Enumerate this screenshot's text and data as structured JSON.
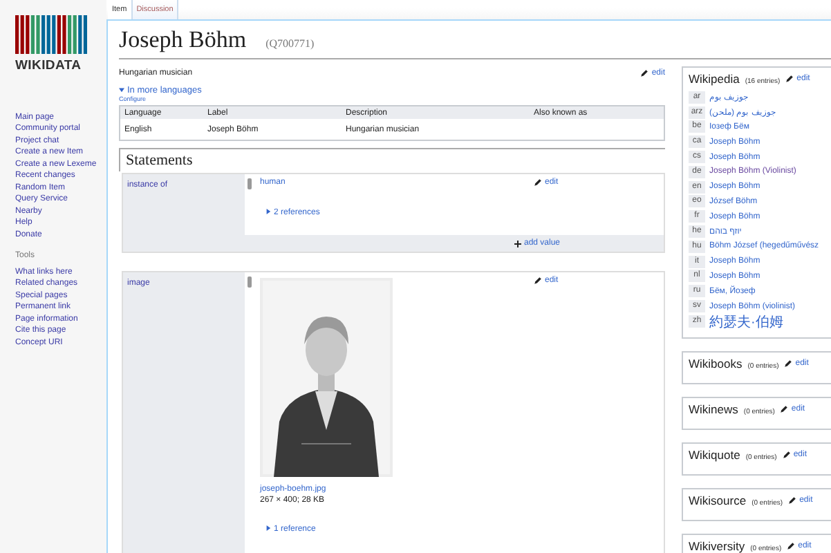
{
  "logo": {
    "wordmark": "WIKIDATA"
  },
  "sidebar": {
    "navigation": [
      "Main page",
      "Community portal",
      "Project chat",
      "Create a new Item",
      "Create a new Lexeme",
      "Recent changes",
      "Random Item",
      "Query Service",
      "Nearby",
      "Help",
      "Donate"
    ],
    "tools_heading": "Tools",
    "tools": [
      "What links here",
      "Related changes",
      "Special pages",
      "Permanent link",
      "Page information",
      "Cite this page",
      "Concept URI"
    ]
  },
  "tabs": [
    {
      "label": "Item",
      "selected": true
    },
    {
      "label": "Discussion",
      "selected": false
    }
  ],
  "title": {
    "label": "Joseph Böhm",
    "id": "(Q700771)"
  },
  "description": {
    "text": "Hungarian musician",
    "edit": "edit"
  },
  "languages": {
    "toggle": "In more languages",
    "configure": "Configure",
    "columns": [
      "Language",
      "Label",
      "Description",
      "Also known as"
    ],
    "rows": [
      {
        "language": "English",
        "label": "Joseph Böhm",
        "description": "Hungarian musician"
      }
    ]
  },
  "statements": {
    "heading": "Statements",
    "groups": [
      {
        "kind": "item",
        "property": "instance of",
        "value": "human",
        "edit": "edit",
        "references": "2 references",
        "add_value": "add value"
      },
      {
        "property": "image",
        "file": "joseph-boehm.jpg",
        "file_info": "267 × 400; 28 KB",
        "edit": "edit",
        "references": "1 reference"
      }
    ]
  },
  "sitelinks": [
    {
      "title": "Wikipedia",
      "count": "(16 entries)",
      "edit": "edit",
      "links": [
        {
          "code": "ar",
          "title": "جوزيف بوم",
          "kind": "rtl",
          "visited": false
        },
        {
          "code": "arz",
          "title": "جوزيف بوم (ملحن)",
          "kind": "rtl",
          "visited": false
        },
        {
          "code": "be",
          "title": "Іозеф Бём",
          "kind": "ltr",
          "visited": false
        },
        {
          "code": "ca",
          "title": "Joseph Böhm",
          "kind": "ltr",
          "visited": false
        },
        {
          "code": "cs",
          "title": "Joseph Böhm",
          "kind": "ltr",
          "visited": false
        },
        {
          "code": "de",
          "title": "Joseph Böhm (Violinist)",
          "kind": "ltr",
          "visited": true
        },
        {
          "code": "en",
          "title": "Joseph Böhm",
          "kind": "ltr",
          "visited": false
        },
        {
          "code": "eo",
          "title": "József Böhm",
          "kind": "ltr",
          "visited": false
        },
        {
          "code": "fr",
          "title": "Joseph Böhm",
          "kind": "ltr",
          "visited": false
        },
        {
          "code": "he",
          "title": "יוזף בוהם",
          "kind": "rtl",
          "visited": false
        },
        {
          "code": "hu",
          "title": "Böhm József (hegedűművész",
          "kind": "ltr",
          "visited": false
        },
        {
          "code": "it",
          "title": "Joseph Böhm",
          "kind": "ltr",
          "visited": false
        },
        {
          "code": "nl",
          "title": "Joseph Böhm",
          "kind": "ltr",
          "visited": false
        },
        {
          "code": "ru",
          "title": "Бём, Йозеф",
          "kind": "ltr",
          "visited": false
        },
        {
          "code": "sv",
          "title": "Joseph Böhm (violinist)",
          "kind": "ltr",
          "visited": false
        },
        {
          "code": "zh",
          "title": "約瑟夫·伯姆",
          "kind": "cjk",
          "visited": false
        }
      ]
    },
    {
      "title": "Wikibooks",
      "count": "(0 entries)",
      "edit": "edit"
    },
    {
      "title": "Wikinews",
      "count": "(0 entries)",
      "edit": "edit"
    },
    {
      "title": "Wikiquote",
      "count": "(0 entries)",
      "edit": "edit"
    },
    {
      "title": "Wikisource",
      "count": "(0 entries)",
      "edit": "edit"
    },
    {
      "title": "Wikiversity",
      "count": "(0 entries)",
      "edit": "edit"
    }
  ]
}
